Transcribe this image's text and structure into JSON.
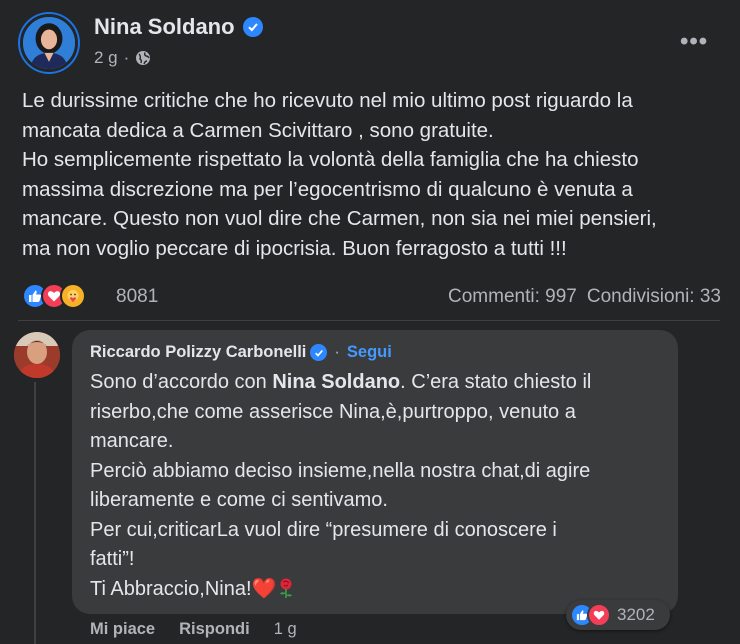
{
  "post": {
    "author": "Nina Soldano",
    "time": "2 g",
    "more_label": "•••",
    "text": "Le durissime critiche che ho ricevuto nel mio ultimo post riguardo la\nmancata dedica a Carmen Scivittaro , sono gratuite.\nHo semplicemente rispettato la volontà della famiglia che ha chiesto\nmassima discrezione ma per l’egocentrismo di qualcuno è venuta a\nmancare. Questo non vuol dire che Carmen, non sia nei miei pensieri,\nma non voglio peccare di ipocrisia. Buon ferragosto a tutti !!!",
    "reaction_icons": [
      "like-icon",
      "love-icon",
      "care-icon"
    ],
    "reaction_count": "8081",
    "comments": "Commenti: 997",
    "shares": "Condivisioni: 33"
  },
  "comment": {
    "author": "Riccardo Polizzy Carbonelli",
    "separator": "·",
    "follow_label": "Segui",
    "line1_pre": "Sono d’accordo con ",
    "line1_bold": "Nina Soldano",
    "line1_post": ". C’era stato chiesto il",
    "line2": "riserbo,che come asserisce Nina,è,purtroppo, venuto a",
    "line3": "mancare.",
    "line4": "Perciò abbiamo deciso insieme,nella nostra chat,di agire",
    "line5": "liberamente e come ci sentivamo.",
    "line6": "Per cui,criticarLa vuol dire “presumere di conoscere i",
    "line7": "fatti”!",
    "line8": "Ti Abbraccio,Nina!",
    "line8_heart": "❤️",
    "reaction_icons": [
      "like-icon",
      "love-icon"
    ],
    "reaction_count": "3202",
    "like_label": "Mi piace",
    "reply_label": "Rispondi",
    "time": "1 g"
  },
  "colors": {
    "background": "#242526",
    "bubble": "#3a3b3c",
    "text": "#e4e6eb",
    "secondary": "#b0b3b8",
    "link": "#4599ff",
    "like": "#2d88ff",
    "love": "#f33e58"
  }
}
